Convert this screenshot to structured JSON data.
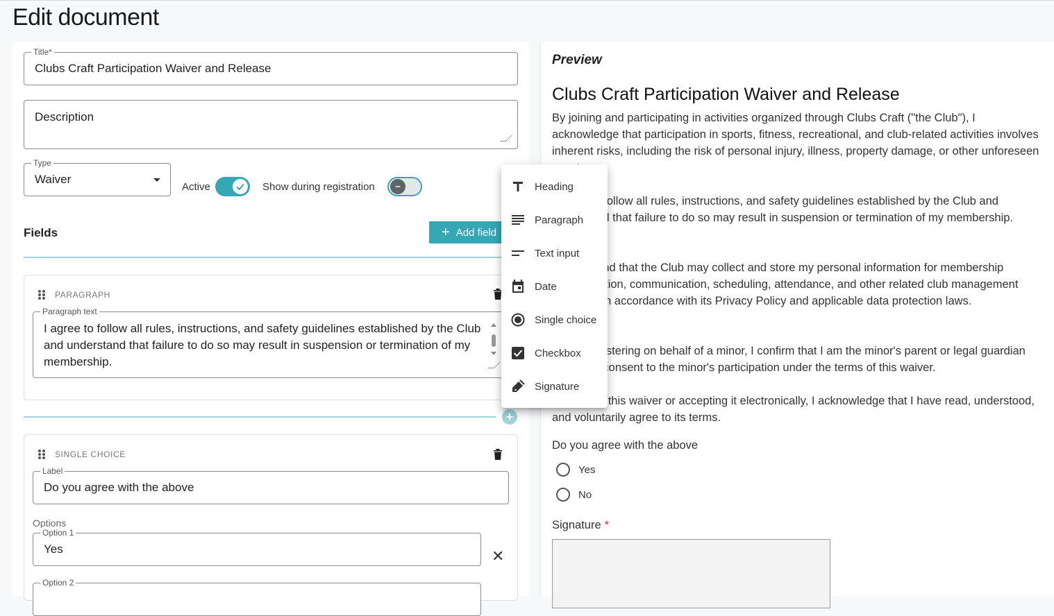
{
  "page": {
    "title": "Edit document"
  },
  "form": {
    "title_label": "Title*",
    "title_value": "Clubs Craft Participation Waiver and Release",
    "description_placeholder": "Description",
    "type_label": "Type",
    "type_value": "Waiver",
    "active_label": "Active",
    "active_on": true,
    "show_registration_label": "Show during registration",
    "show_registration_on": false,
    "fields_title": "Fields",
    "add_field_label": "Add field"
  },
  "fields": [
    {
      "type_label": "PARAGRAPH",
      "text_label": "Paragraph text",
      "text_value": "I agree to follow all rules, instructions, and safety guidelines established by the Club and understand that failure to do so may result in suspension or termination of my membership."
    },
    {
      "type_label": "SINGLE CHOICE",
      "label_caption": "Label",
      "label_value": "Do you agree with the above",
      "options_caption": "Options",
      "options": [
        {
          "caption": "Option 1",
          "value": "Yes"
        },
        {
          "caption": "Option 2",
          "value": ""
        }
      ]
    }
  ],
  "add_menu": {
    "items": [
      {
        "label": "Heading",
        "icon": "heading-icon"
      },
      {
        "label": "Paragraph",
        "icon": "paragraph-icon"
      },
      {
        "label": "Text input",
        "icon": "text-input-icon"
      },
      {
        "label": "Date",
        "icon": "calendar-icon"
      },
      {
        "label": "Single choice",
        "icon": "radio-icon"
      },
      {
        "label": "Checkbox",
        "icon": "checkbox-icon"
      },
      {
        "label": "Signature",
        "icon": "signature-icon"
      }
    ]
  },
  "preview": {
    "label": "Preview",
    "title": "Clubs Craft Participation Waiver and Release",
    "paragraphs": [
      "By joining and participating in activities organized through Clubs Craft (\"the Club\"), I acknowledge that participation in sports, fitness, recreational, and club-related activities involves inherent risks, including the risk of personal injury, illness, property damage, or other unforeseen events.",
      "I agree to follow all rules, instructions, and safety guidelines established by the Club and understand that failure to do so may result in suspension or termination of my membership.",
      "I understand that the Club may collect and store my personal information for membership administration, communication, scheduling, attendance, and other related club management purposes in accordance with its Privacy Policy and applicable data protection laws.",
      "If I am registering on behalf of a minor, I confirm that I am the minor's parent or legal guardian and that I consent to the minor's participation under the terms of this waiver.",
      "By signing this waiver or accepting it electronically, I acknowledge that I have read, understood, and voluntarily agree to its terms."
    ],
    "question": "Do you agree with the above",
    "choices": [
      "Yes",
      "No"
    ],
    "signature_label": "Signature",
    "signature_required_mark": "*"
  },
  "colors": {
    "accent": "#35a7b5",
    "accent_light": "#9fd6dc",
    "required": "#d32f2f"
  }
}
